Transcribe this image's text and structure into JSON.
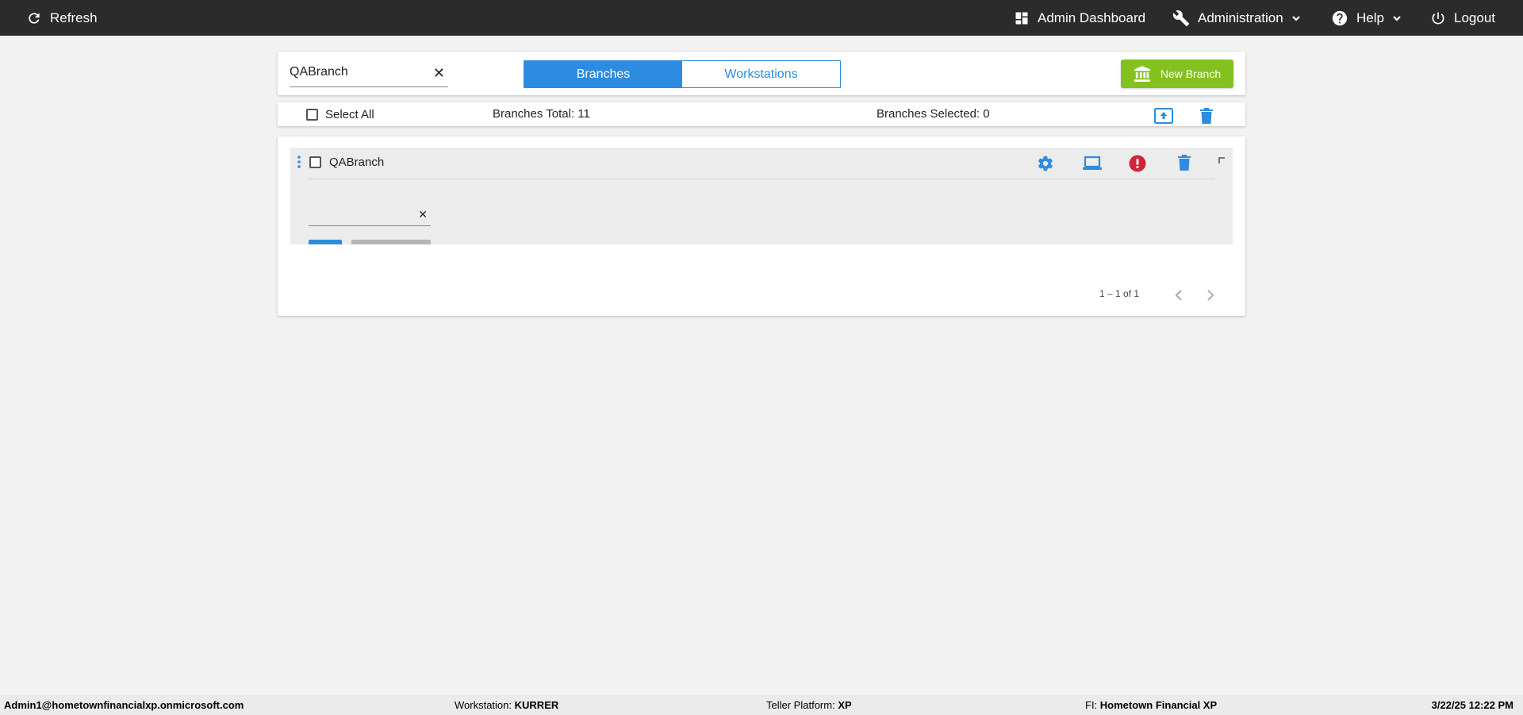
{
  "topbar": {
    "refresh_label": "Refresh",
    "dashboard_label": "Admin Dashboard",
    "administration_label": "Administration",
    "help_label": "Help",
    "logout_label": "Logout"
  },
  "search": {
    "value": "QABranch",
    "clear_symbol": "✕"
  },
  "tabs": {
    "branches_label": "Branches",
    "workstations_label": "Workstations",
    "active": "Branches"
  },
  "new_branch_label": "New Branch",
  "summary": {
    "select_all_label": "Select All",
    "total_label": "Branches Total: 11",
    "selected_label": "Branches Selected: 0"
  },
  "branch_row": {
    "name": "QABranch",
    "edit_clear_symbol": "✕",
    "edit_value": ""
  },
  "pagination": {
    "range_label": "1 – 1 of 1"
  },
  "footer": {
    "user": "Admin1@hometownfinancialxp.onmicrosoft.com",
    "workstation_label": "Workstation:",
    "workstation_value": "KURRER",
    "platform_label": "Teller Platform:",
    "platform_value": "XP",
    "fi_label": "FI:",
    "fi_value": "Hometown Financial XP",
    "datetime": "3/22/25 12:22 PM"
  },
  "colors": {
    "accent_blue": "#2d8ce0",
    "new_branch_green": "#83c21e",
    "info_red": "#d0243a",
    "topbar_bg": "#2b2b2b"
  },
  "icons": [
    "refresh-icon",
    "dashboard-icon",
    "wrench-icon",
    "help-icon",
    "power-icon",
    "bank-icon",
    "gear-icon",
    "laptop-icon",
    "info-icon",
    "trash-icon",
    "upload-icon",
    "drag-handle-icon"
  ]
}
